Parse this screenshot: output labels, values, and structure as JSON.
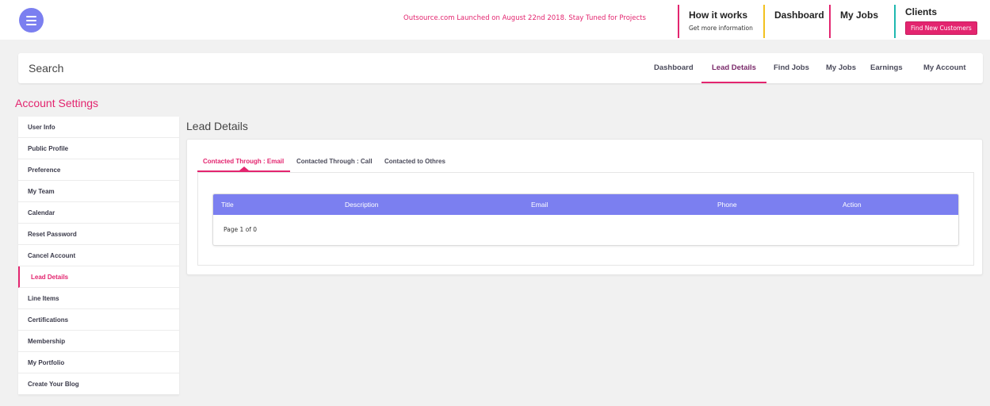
{
  "header": {
    "announcement": "Outsource.com Launched on August 22nd 2018. Stay Tuned for Projects",
    "nav": {
      "how_it_works": "How it works",
      "how_it_works_sub": "Get more information",
      "dashboard": "Dashboard",
      "my_jobs": "My Jobs",
      "clients": "Clients",
      "find_customers": "Find New Customers"
    }
  },
  "search": {
    "label": "Search"
  },
  "subnav": [
    "Dashboard",
    "Lead Details",
    "Find Jobs",
    "My Jobs",
    "Earnings",
    "My Account"
  ],
  "sidebar": {
    "title": "Account Settings",
    "items": [
      "User Info",
      "Public Profile",
      "Preference",
      "My Team",
      "Calendar",
      "Reset Password",
      "Cancel Account",
      "Lead Details",
      "Line Items",
      "Certifications",
      "Membership",
      "My Portfolio",
      "Create Your Blog"
    ]
  },
  "main": {
    "title": "Lead Details",
    "tabs": [
      "Contacted Through : Email",
      "Contacted Through : Call",
      "Contacted to Othres"
    ],
    "table": {
      "columns": [
        "Title",
        "Description",
        "Email",
        "Phone",
        "Action"
      ],
      "page_info": "Page 1 of 0"
    }
  },
  "colors": {
    "accent": "#e3256f",
    "header_purple": "#7b7ff0"
  }
}
